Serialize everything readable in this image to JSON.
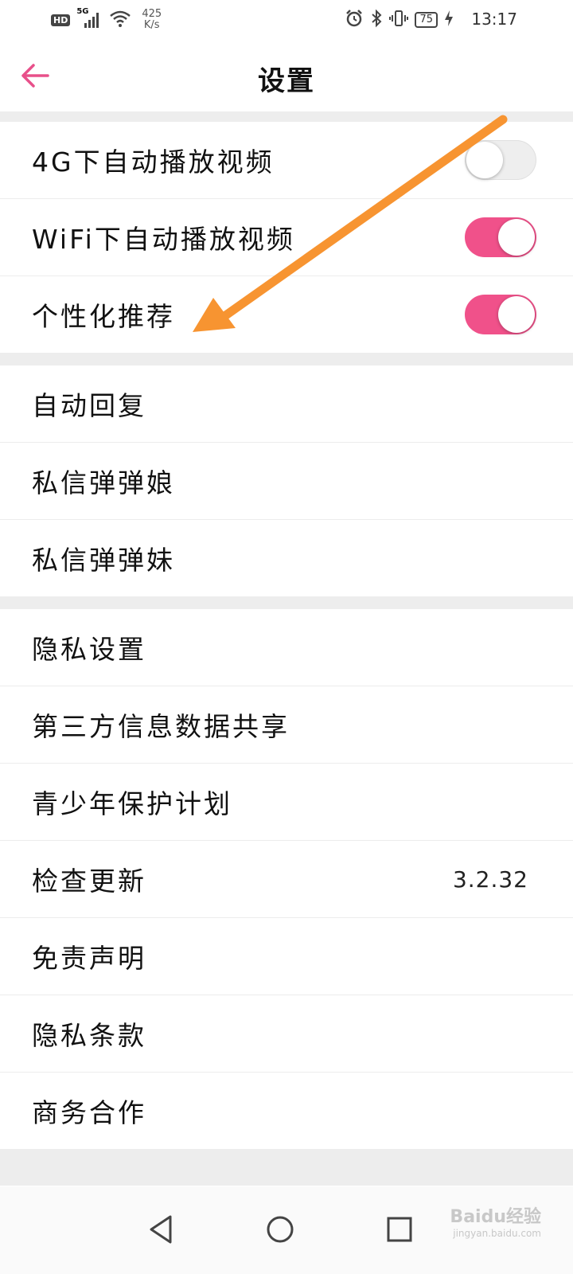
{
  "status_bar": {
    "hd": "HD",
    "network": "5G",
    "speed_value": "425",
    "speed_unit": "K/s",
    "battery": "75",
    "time": "13:17"
  },
  "header": {
    "title": "设置"
  },
  "sections": [
    {
      "rows": [
        {
          "label": "4G下自动播放视频",
          "toggle": false
        },
        {
          "label": "WiFi下自动播放视频",
          "toggle": true
        },
        {
          "label": "个性化推荐",
          "toggle": true
        }
      ]
    },
    {
      "rows": [
        {
          "label": "自动回复"
        },
        {
          "label": "私信弹弹娘"
        },
        {
          "label": "私信弹弹妹"
        }
      ]
    },
    {
      "rows": [
        {
          "label": "隐私设置"
        },
        {
          "label": "第三方信息数据共享"
        },
        {
          "label": "青少年保护计划"
        },
        {
          "label": "检查更新",
          "value": "3.2.32"
        },
        {
          "label": "免责声明"
        },
        {
          "label": "隐私条款"
        },
        {
          "label": "商务合作"
        }
      ]
    }
  ],
  "watermark": {
    "text": "Baidu经验",
    "url": "jingyan.baidu.com"
  },
  "colors": {
    "accent": "#f0518a",
    "arrow": "#f79431"
  },
  "icons": [
    "back-arrow-icon",
    "back-triangle-icon",
    "home-circle-icon",
    "recents-square-icon"
  ]
}
